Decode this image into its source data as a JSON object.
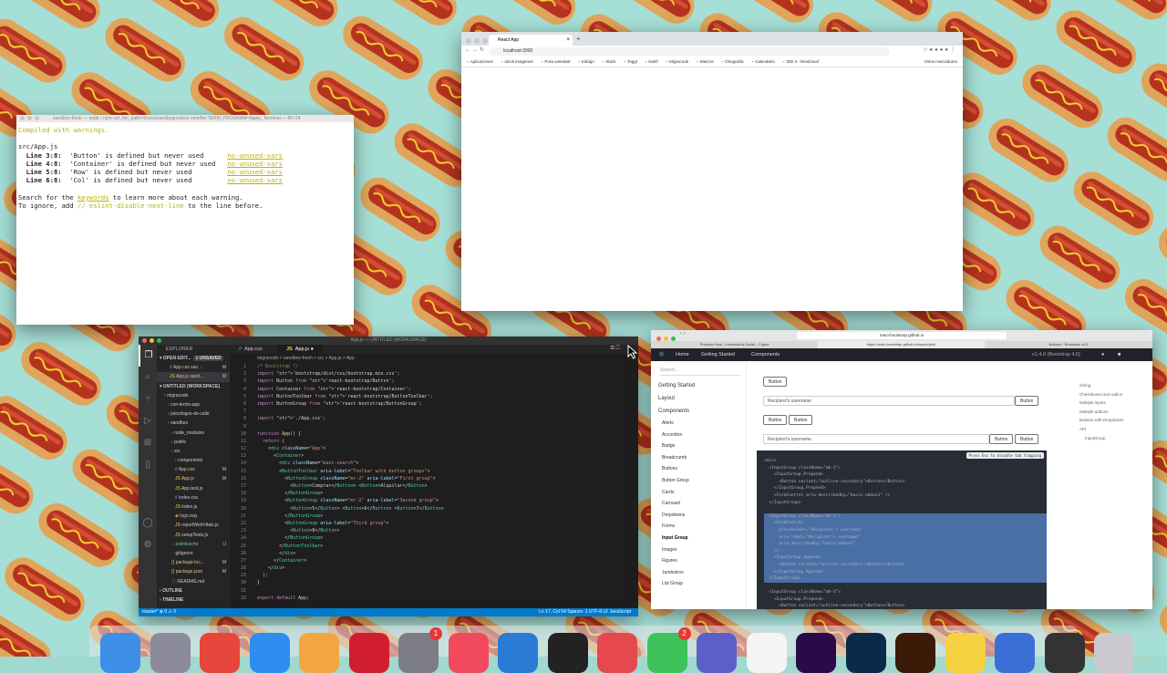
{
  "terminal": {
    "title": "sandbox-fresh — node › npm run_bin_path=/Users/sandbogocatex/.nvm/bin TERM_PROGRAM=Apple_Terminal — 80×24",
    "lines": [
      {
        "t": "Compiled with warnings.",
        "c": "yel"
      },
      {
        "t": "",
        "c": ""
      },
      {
        "t": "src/App.js",
        "c": ""
      },
      {
        "line": "Line 3:8:",
        "msg": "'Button' is defined but never used   ",
        "rule": "no-unused-vars"
      },
      {
        "line": "Line 4:8:",
        "msg": "'Container' is defined but never used",
        "rule": "no-unused-vars"
      },
      {
        "line": "Line 5:8:",
        "msg": "'Row' is defined but never used      ",
        "rule": "no-unused-vars"
      },
      {
        "line": "Line 6:8:",
        "msg": "'Col' is defined but never used      ",
        "rule": "no-unused-vars"
      },
      {
        "t": "",
        "c": ""
      }
    ],
    "search_pre": "Search for the ",
    "search_kw": "keywords",
    "search_post": " to learn more about each warning.",
    "ignore_pre": "To ignore, add ",
    "ignore_kw": "// eslint-disable-next-line",
    "ignore_post": " to the line before."
  },
  "chrome": {
    "tab_title": "React App",
    "url": "localhost:3000",
    "bookmarks": [
      "Aplicaciones",
      "stock imagenes",
      "Pura variedad",
      "trabajo",
      "Slack",
      "Toggl",
      "Notifi",
      "Migracode",
      "Macros",
      "Ortografía",
      "Calendario",
      "IDD 3 - Nextcloud"
    ],
    "other_bookmarks": "Otros marcadores"
  },
  "vscode": {
    "window_title": "App.js — UNTITLED (WORKSPACE)",
    "explorer_label": "EXPLORER",
    "open_editors": "OPEN EDIT...",
    "unsaved": "1 UNSAVED",
    "workspace": "UNTITLED (WORKSPACE)",
    "tree": [
      {
        "name": "App.css  san...",
        "badge": "M",
        "indent": 14,
        "icon": "css"
      },
      {
        "name": "App.js  sand...",
        "badge": "M",
        "indent": 14,
        "icon": "js",
        "sel": true
      },
      {
        "name": "migracode",
        "badge": "",
        "indent": 8,
        "icon": "folder"
      },
      {
        "name": "con-techo-app",
        "badge": "",
        "indent": 12,
        "icon": "folder"
      },
      {
        "name": "psicologxs-de-calle",
        "badge": "",
        "indent": 12,
        "icon": "folder"
      },
      {
        "name": "sandbox",
        "badge": "",
        "indent": 12,
        "icon": "folder"
      },
      {
        "name": "node_modules",
        "badge": "",
        "indent": 16,
        "icon": "folder"
      },
      {
        "name": "public",
        "badge": "",
        "indent": 16,
        "icon": "folder"
      },
      {
        "name": "src",
        "badge": "",
        "indent": 16,
        "icon": "folder"
      },
      {
        "name": "components",
        "badge": "",
        "indent": 20,
        "icon": "folder"
      },
      {
        "name": "App.css",
        "badge": "M",
        "indent": 20,
        "icon": "css"
      },
      {
        "name": "App.js",
        "badge": "M",
        "indent": 20,
        "icon": "js"
      },
      {
        "name": "App.test.js",
        "badge": "",
        "indent": 20,
        "icon": "js"
      },
      {
        "name": "index.css",
        "badge": "",
        "indent": 20,
        "icon": "css"
      },
      {
        "name": "index.js",
        "badge": "",
        "indent": 20,
        "icon": "js"
      },
      {
        "name": "logo.svg",
        "badge": "",
        "indent": 20,
        "icon": "svg"
      },
      {
        "name": "reportWebVitals.js",
        "badge": "",
        "indent": 20,
        "icon": "js"
      },
      {
        "name": "setupTests.js",
        "badge": "",
        "indent": 20,
        "icon": "js"
      },
      {
        "name": ".eslintcache",
        "badge": "U",
        "indent": 16,
        "icon": "file"
      },
      {
        "name": ".gitignore",
        "badge": "",
        "indent": 16,
        "icon": "file"
      },
      {
        "name": "package-loc...",
        "badge": "M",
        "indent": 16,
        "icon": "json"
      },
      {
        "name": "package.json",
        "badge": "M",
        "indent": 16,
        "icon": "json"
      },
      {
        "name": "README.md",
        "badge": "",
        "indent": 16,
        "icon": "md"
      }
    ],
    "outline": "OUTLINE",
    "timeline": "TIMELINE",
    "tabs": [
      "App.css",
      "App.js"
    ],
    "breadcrumb": "migracode > sandbox-fresh > src > App.js > App",
    "code_lines": [
      "/* Bootstrap */",
      "import 'bootstrap/dist/css/bootstrap.min.css';",
      "import Button from 'react-bootstrap/Button';",
      "import Container from 'react-bootstrap/Container';",
      "import ButtonToolbar from 'react-bootstrap/ButtonToolbar';",
      "import ButtonGroup from 'react-bootstrap/ButtonGroup';",
      "",
      "import './App.css';",
      "",
      "function App() {",
      "  return (",
      "    <div className=\"App\">",
      "      <Container>",
      "        <div className=\"main-search\">",
      "        <ButtonToolbar aria-label=\"Toolbar with button groups\">",
      "          <ButtonGroup className=\"mr-2\" aria-label=\"First group\">",
      "            <Button>Comprar</Button> <Button>Alquilar</Button>",
      "          </ButtonGroup>",
      "          <ButtonGroup className=\"mr-2\" aria-label=\"Second group\">",
      "            <Button>5</Button> <Button>6</Button> <Button>7</Button>",
      "          </ButtonGroup>",
      "          <ButtonGroup aria-label=\"Third group\">",
      "            <Button>8</Button>",
      "          </ButtonGroup>",
      "        </ButtonToolbar>",
      "        </div>",
      "      </Container>",
      "    </div>",
      "  );",
      "}",
      "",
      "export default App;"
    ],
    "status_left": "master*   ⊗ 0 ⚠ 0",
    "status_right": "Ln 17, Col 54   Spaces: 2   UTF-8   LF   JavaScript"
  },
  "safari": {
    "url": "react-bootstrap.github.io",
    "tabs": [
      "Proyecto final - Inmobiliaria Social – Figma",
      "https://react-bootstrap.github.io/layout/grid/",
      "Buttons · Bootstrap v4.5"
    ],
    "nav": {
      "home": "Home",
      "getting_started": "Getting Started",
      "components": "Components",
      "version": "v1.4.0 (Bootstrap 4.5)"
    },
    "search_placeholder": "Search...",
    "side_top": [
      "Getting Started",
      "Layout"
    ],
    "side_header": "Components",
    "side_items": [
      "Alerts",
      "Accordion",
      "Badge",
      "Breadcrumb",
      "Buttons",
      "Button Group",
      "Cards",
      "Carousel",
      "Dropdowns",
      "Forms",
      "Input Group",
      "Images",
      "Figures",
      "Jumbotron",
      "List Group"
    ],
    "active_item": "Input Group",
    "button_label": "Button",
    "recipient_placeholder": "Recipient's username",
    "toc": [
      "Sizing",
      "Checkboxes and radios",
      "Multiple inputs",
      "Multiple addons",
      "Buttons with Dropdowns",
      "API",
      "InputGroup"
    ],
    "tip": "Press Esc to disable tab trapping",
    "code_lines": [
      "<div>",
      "  <InputGroup className=\"mb-3\">",
      "    <InputGroup.Prepend>",
      "      <Button variant=\"outline-secondary\">Button</Button>",
      "    </InputGroup.Prepend>",
      "    <FormControl aria-describedby=\"basic-addon1\" />",
      "  </InputGroup>",
      "",
      "  <InputGroup className=\"mb-3\">",
      "    <FormControl",
      "      placeholder=\"Recipient's username\"",
      "      aria-label=\"Recipient's username\"",
      "      aria-describedby=\"basic-addon2\"",
      "    />",
      "    <InputGroup.Append>",
      "      <Button variant=\"outline-secondary\">Button</Button>",
      "    </InputGroup.Append>",
      "  </InputGroup>",
      "",
      "  <InputGroup className=\"mb-3\">",
      "    <InputGroup.Prepend>",
      "      <Button variant=\"outline-secondary\">Button</Button>"
    ]
  },
  "dock": {
    "apps": [
      {
        "name": "finder-icon",
        "color": "#3d8fe8"
      },
      {
        "name": "launchpad-icon",
        "color": "#8b8b9a"
      },
      {
        "name": "chrome-icon",
        "color": "#e8453c"
      },
      {
        "name": "safari-icon",
        "color": "#2d8ef0"
      },
      {
        "name": "photos-icon",
        "color": "#f2a640"
      },
      {
        "name": "opera-icon",
        "color": "#d01e2e"
      },
      {
        "name": "system-preferences-icon",
        "color": "#7d7d86"
      },
      {
        "name": "music-icon",
        "color": "#f04a5c"
      },
      {
        "name": "vscode-icon",
        "color": "#2a7bd6"
      },
      {
        "name": "terminal-icon",
        "color": "#222222"
      },
      {
        "name": "toggl-icon",
        "color": "#e5484d"
      },
      {
        "name": "messages-icon",
        "color": "#3ec25a"
      },
      {
        "name": "teams-icon",
        "color": "#5b5fc7"
      },
      {
        "name": "slack-icon",
        "color": "#f4f4f4"
      },
      {
        "name": "premiere-icon",
        "color": "#2b0a4a"
      },
      {
        "name": "photoshop-icon",
        "color": "#0b2a4a"
      },
      {
        "name": "illustrator-icon",
        "color": "#3b1a08"
      },
      {
        "name": "cyberduck-icon",
        "color": "#f5d142"
      },
      {
        "name": "app-icon",
        "color": "#3b6fd8"
      },
      {
        "name": "calculator-icon",
        "color": "#333333"
      },
      {
        "name": "trash-icon",
        "color": "#c9c9cf"
      }
    ],
    "badges": [
      {
        "app": "system-preferences-icon",
        "value": "1"
      },
      {
        "app": "messages-icon",
        "value": "2"
      }
    ]
  },
  "colors": {
    "vscode_status": "#007acc",
    "rb_nav": "#20232a",
    "code_highlight": "#4a6fa5"
  }
}
